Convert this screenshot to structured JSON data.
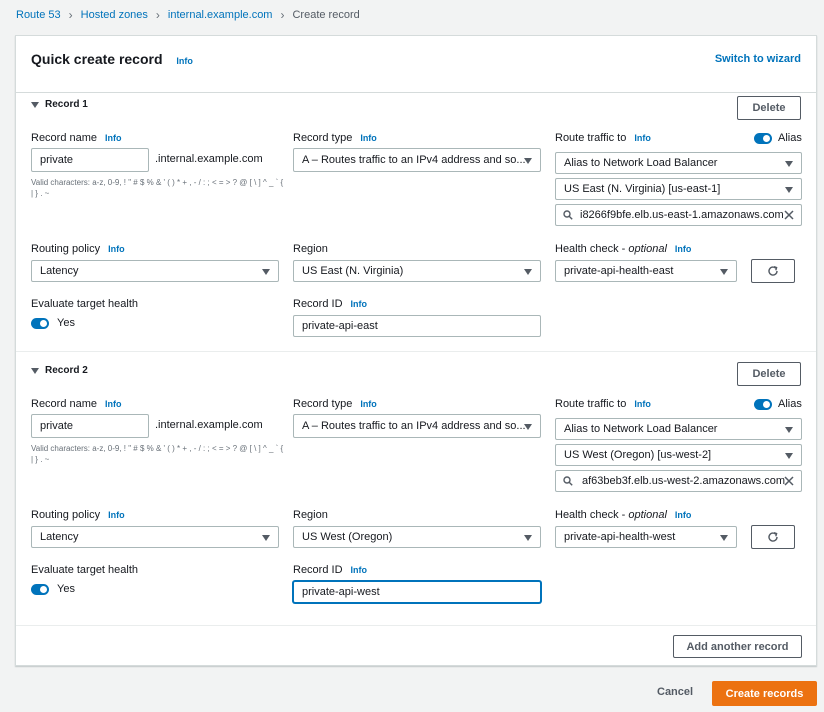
{
  "breadcrumb": [
    "Route 53",
    "Hosted zones",
    "internal.example.com",
    "Create record"
  ],
  "panel": {
    "title": "Quick create record",
    "info": "Info",
    "switch_label": "Switch to wizard"
  },
  "labels": {
    "record_name": "Record name",
    "record_type": "Record type",
    "route_traffic": "Route traffic to",
    "alias": "Alias",
    "routing_policy": "Routing policy",
    "region": "Region",
    "health_check": "Health check - ",
    "optional": "optional",
    "evaluate_health": "Evaluate target health",
    "record_id": "Record ID",
    "info": "Info",
    "yes": "Yes",
    "delete": "Delete",
    "suffix": ".internal.example.com",
    "hint": "Valid characters: a-z, 0-9, ! \" # $ % & ' ( ) * + , - / : ; < = > ? @ [ \\ ] ^ _ ` { | } . ~"
  },
  "records": [
    {
      "title": "Record 1",
      "name": "private",
      "type": "A – Routes traffic to an IPv4 address and so...",
      "alias_target": "Alias to Network Load Balancer",
      "alias_region": "US East (N. Virginia) [us-east-1]",
      "endpoint": "i8266f9bfe.elb.us-east-1.amazonaws.com",
      "routing_policy": "Latency",
      "region": "US East (N. Virginia)",
      "health_check": "private-api-health-east",
      "record_id": "private-api-east"
    },
    {
      "title": "Record 2",
      "name": "private",
      "type": "A – Routes traffic to an IPv4 address and so...",
      "alias_target": "Alias to Network Load Balancer",
      "alias_region": "US West (Oregon) [us-west-2]",
      "endpoint": "af63beb3f.elb.us-west-2.amazonaws.com",
      "routing_policy": "Latency",
      "region": "US West (Oregon)",
      "health_check": "private-api-health-west",
      "record_id": "private-api-west"
    }
  ],
  "footer": {
    "add_another": "Add another record",
    "cancel": "Cancel",
    "create": "Create records"
  },
  "colors": {
    "link": "#0073bb",
    "primary": "#ec7211",
    "toggle": "#0073bb"
  }
}
